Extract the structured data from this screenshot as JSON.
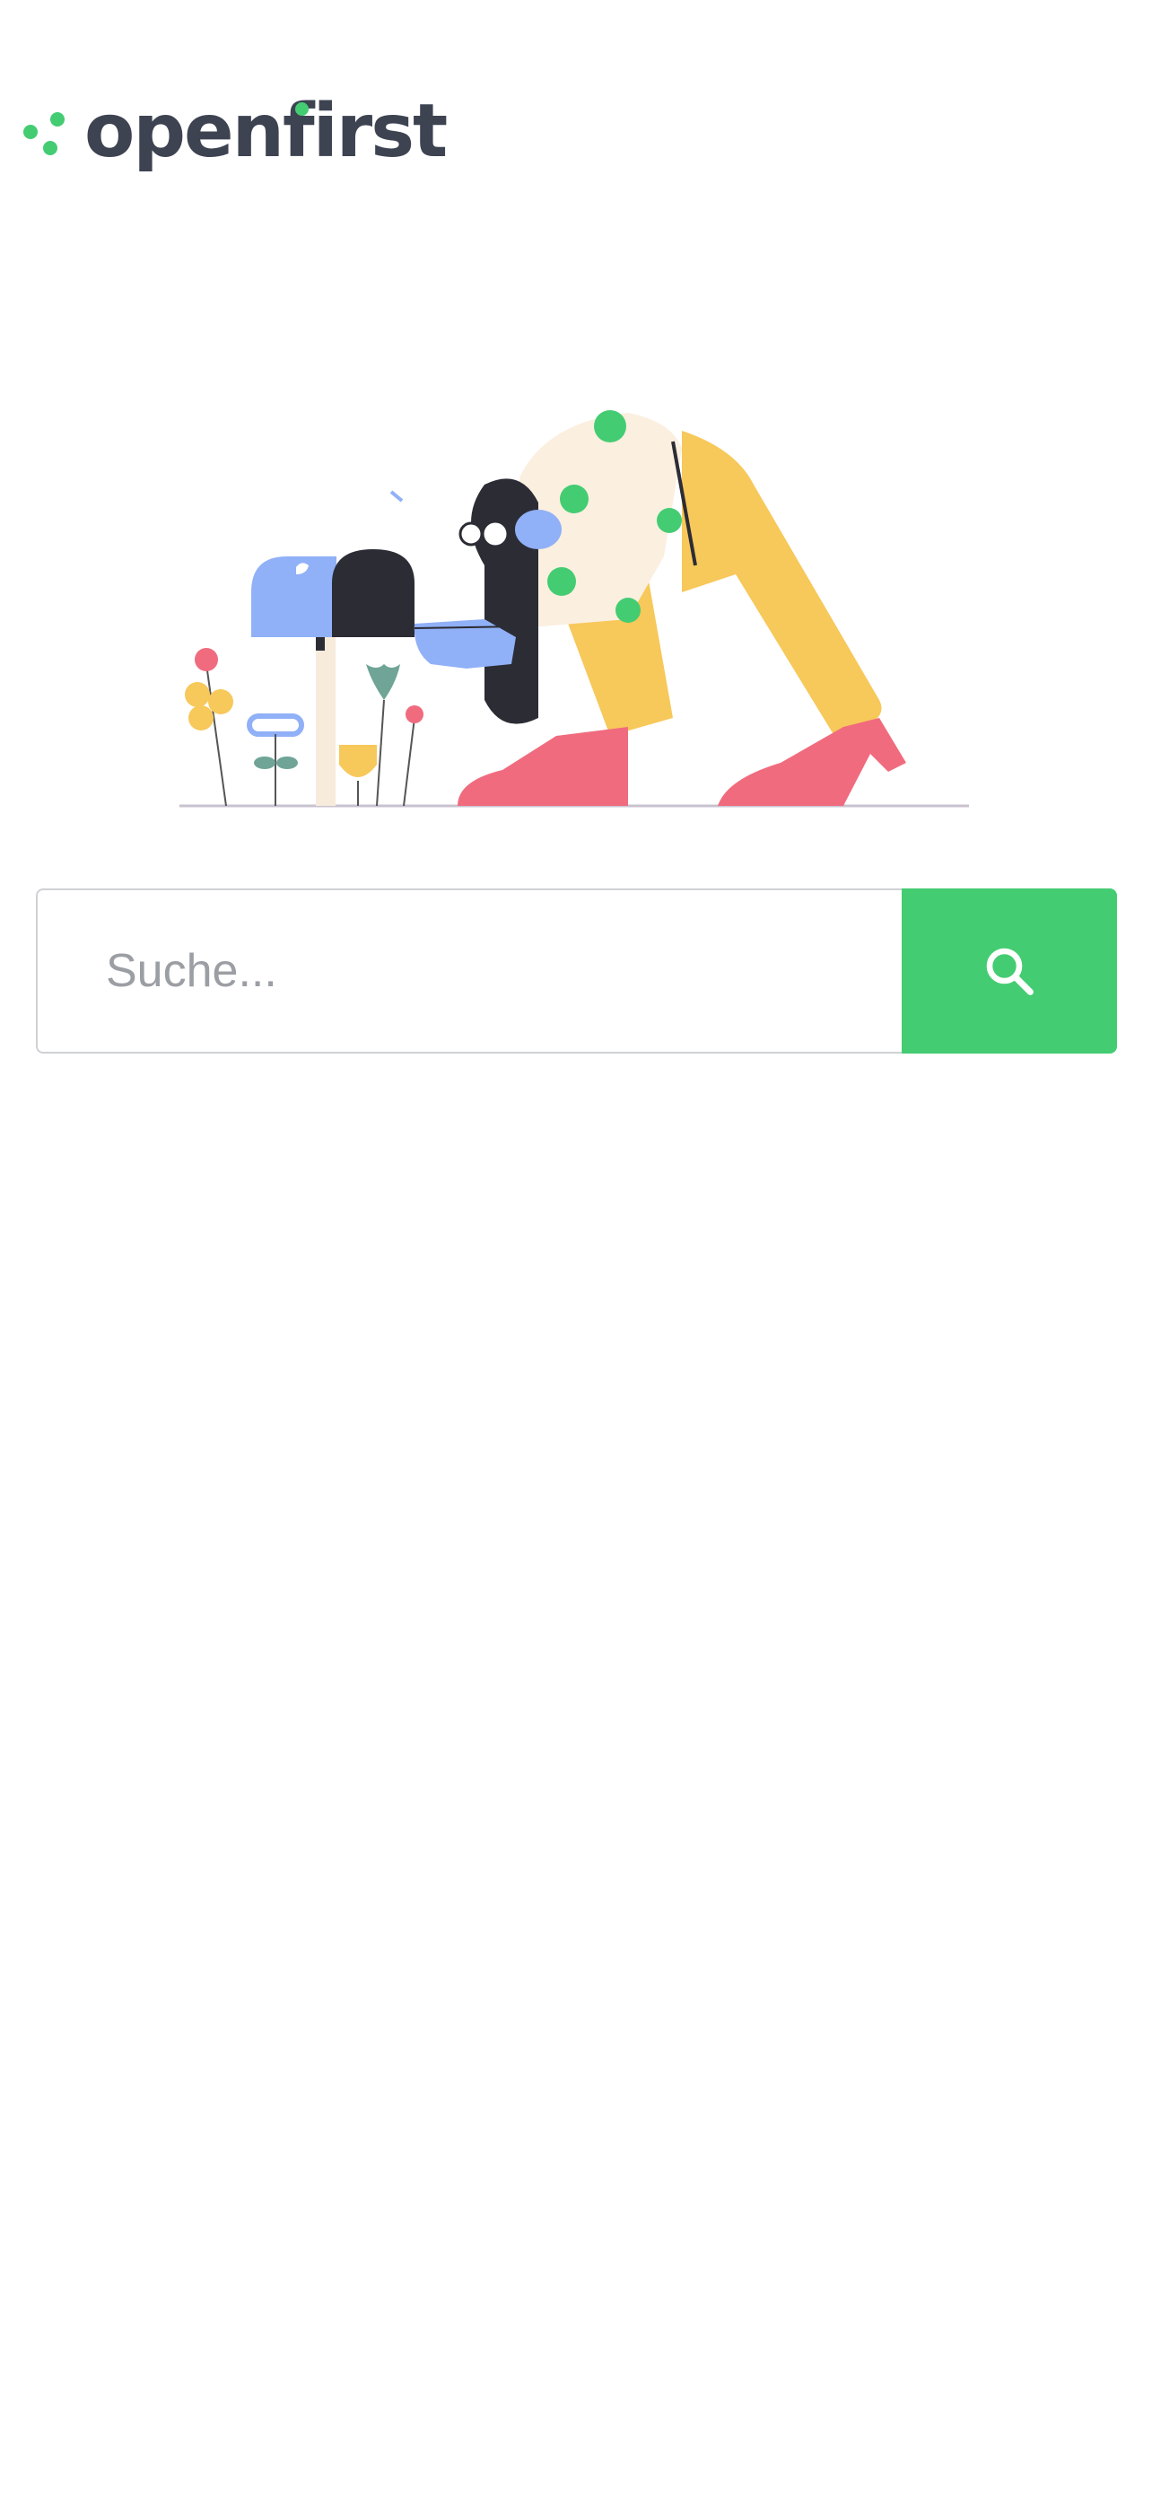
{
  "app": {
    "logo_text": "openfirst",
    "brand_color": "#44cc72",
    "text_color": "#3d4351"
  },
  "illustration": {
    "icon": "woman-checking-mailbox-illustration"
  },
  "search": {
    "placeholder": "Suche...",
    "value": "",
    "button_icon": "search-icon"
  }
}
